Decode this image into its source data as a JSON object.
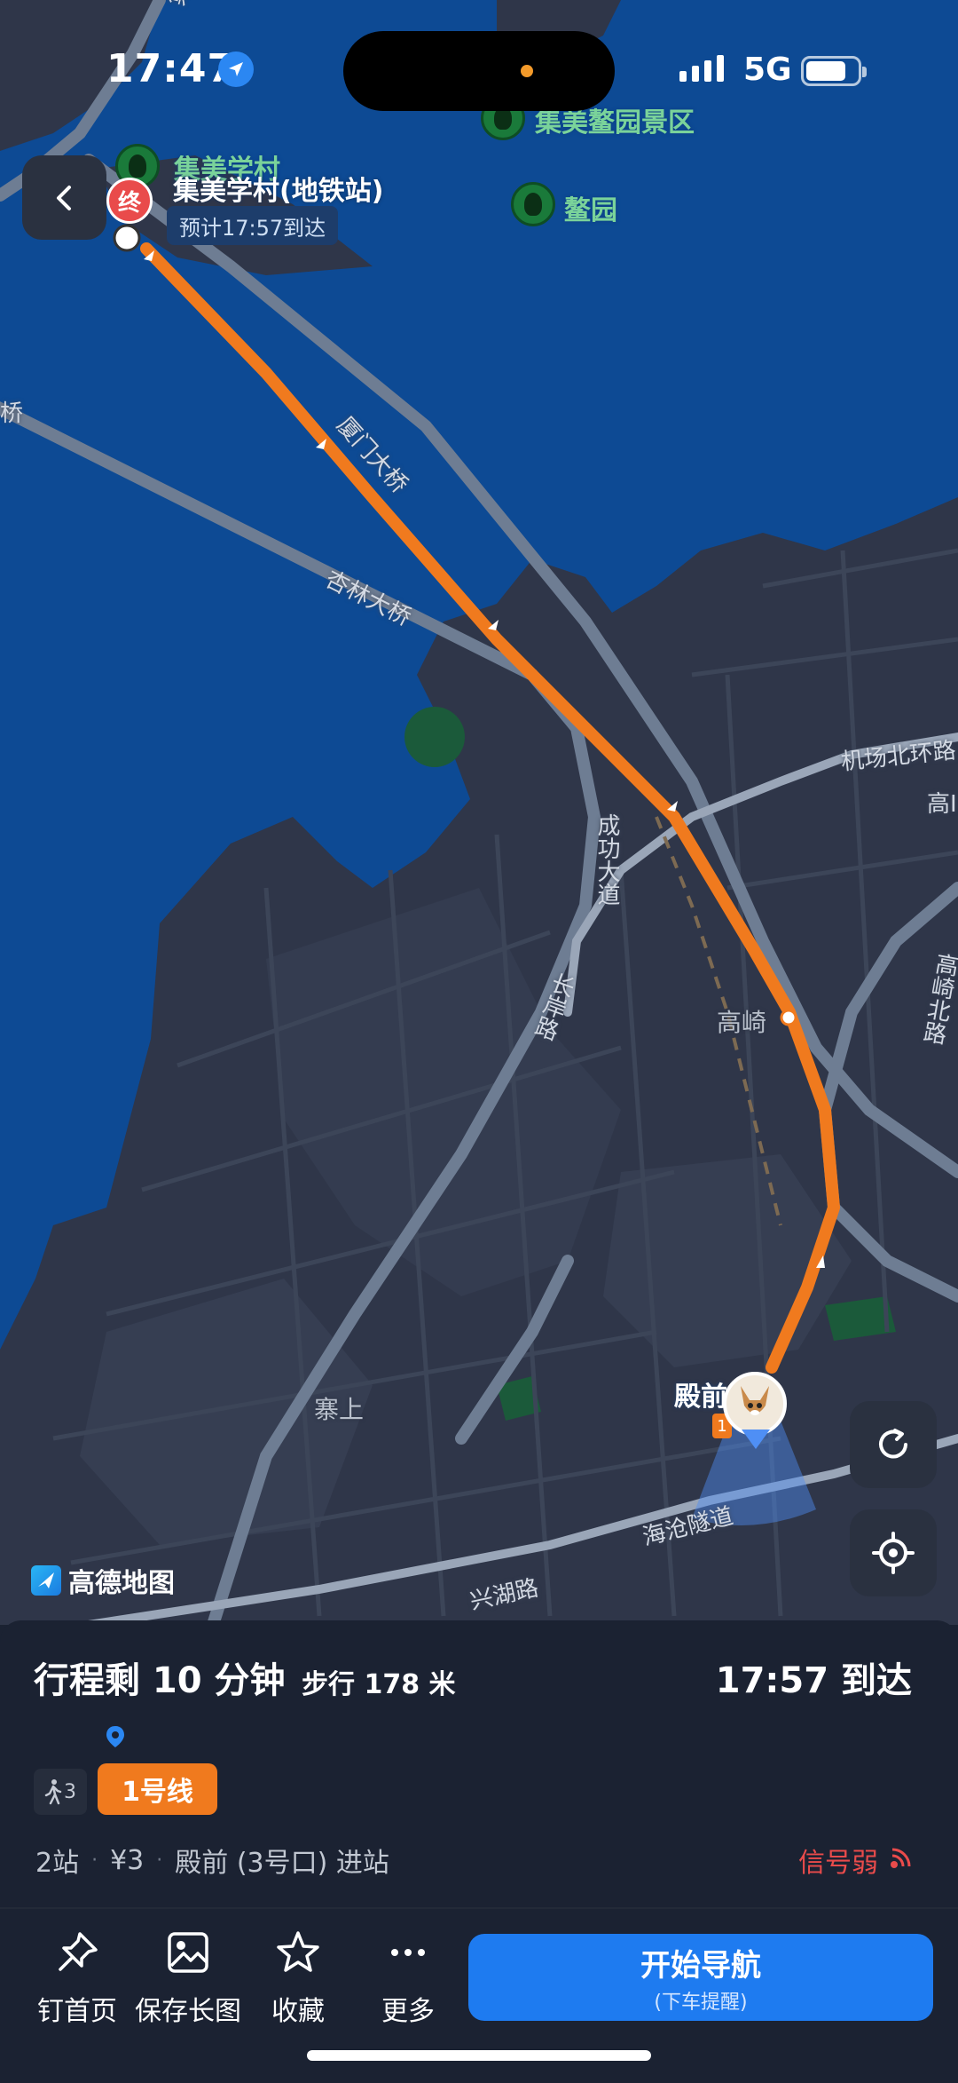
{
  "status_bar": {
    "time": "17:47",
    "network": "5G",
    "location_icon": "location-arrow-icon",
    "battery_icon": "battery-icon",
    "signal_icon": "cellular-signal-icon"
  },
  "map": {
    "labels": {
      "jimei_road": "集美路",
      "jimei_scenic": "集美鳌园景区",
      "jimei_village": "集美学村",
      "aoyuan": "鳌园",
      "bridge_left": "桥",
      "xiamen_bridge": "厦门大桥",
      "xinglin_bridge": "杏林大桥",
      "airport_road": "机场北环路",
      "gaobei": "高I",
      "chenggong": "成功大道",
      "changan": "长岸路",
      "gaoqi": "高崎",
      "gaoqi_north": "高崎北路",
      "zhaishang": "寨上",
      "dianqian": "殿前",
      "haicang_tunnel": "海沧隧道",
      "xinghu": "兴湖路"
    },
    "destination": {
      "pin_label": "终",
      "name": "集美学村(地铁站)",
      "eta_chip": "预计17:57到达"
    },
    "entrance_badge": "1",
    "logo_text": "高德地图",
    "colors": {
      "water": "#0d4a94",
      "land": "#2f3649",
      "route": "#f07a1e",
      "accent": "#1e7bf0"
    }
  },
  "trip": {
    "remain": "行程剩 10 分钟",
    "walk": "步行 178 米",
    "arrive": "17:57 到达",
    "walk_chip_count": "3",
    "line_name": "1号线",
    "details": [
      "2站",
      "¥3",
      "殿前 (3号口) 进站"
    ],
    "signal": "信号弱"
  },
  "actions": [
    {
      "label": "钉首页",
      "icon": "pin-icon"
    },
    {
      "label": "保存长图",
      "icon": "image-icon"
    },
    {
      "label": "收藏",
      "icon": "star-icon"
    },
    {
      "label": "更多",
      "icon": "more-icon"
    }
  ],
  "nav_button": {
    "label": "开始导航",
    "sublabel": "(下车提醒)"
  }
}
